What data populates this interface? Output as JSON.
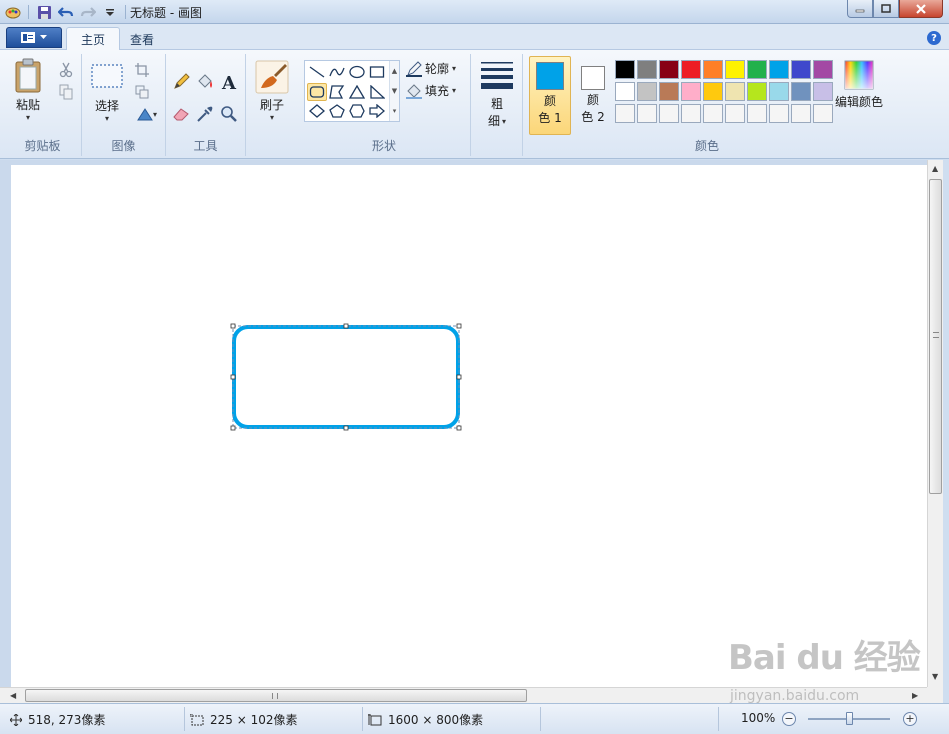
{
  "window": {
    "title": "无标题 - 画图"
  },
  "tabs": [
    {
      "label": "主页",
      "active": true
    },
    {
      "label": "查看",
      "active": false
    }
  ],
  "ribbon": {
    "clipboard": {
      "paste_label": "粘贴",
      "group_label": "剪贴板"
    },
    "image": {
      "select_label": "选择",
      "group_label": "图像"
    },
    "tools": {
      "group_label": "工具"
    },
    "brushes": {
      "label": "刷子"
    },
    "shapes": {
      "outline_label": "轮廓",
      "fill_label": "填充",
      "group_label": "形状"
    },
    "size": {
      "label_line1": "粗",
      "label_line2": "细"
    },
    "colors": {
      "color1_line1": "颜",
      "color1_line2": "色 1",
      "color2_line1": "颜",
      "color2_line2": "色 2",
      "color1_value": "#00a2e8",
      "color2_value": "#ffffff",
      "edit_label": "编辑颜色",
      "group_label": "颜色",
      "palette_row1": [
        "#000000",
        "#7f7f7f",
        "#880015",
        "#ed1c24",
        "#ff7f27",
        "#fff200",
        "#22b14c",
        "#00a2e8",
        "#3f48cc",
        "#a349a4"
      ],
      "palette_row2": [
        "#ffffff",
        "#c3c3c3",
        "#b97a57",
        "#ffaec9",
        "#ffc90e",
        "#efe4b0",
        "#b5e61d",
        "#99d9ea",
        "#7092be",
        "#c8bfe7"
      ],
      "palette_row3": [
        "#f5f5f5",
        "#f5f5f5",
        "#f5f5f5",
        "#f5f5f5",
        "#f5f5f5",
        "#f5f5f5",
        "#f5f5f5",
        "#f5f5f5",
        "#f5f5f5",
        "#f5f5f5"
      ]
    }
  },
  "canvas": {
    "shape_stroke_color": "#00a2e8"
  },
  "status": {
    "cursor_pos": "518, 273像素",
    "selection_size": "225 × 102像素",
    "image_size": "1600 × 800像素",
    "zoom": "100%",
    "zoom_level": 0.5
  },
  "watermark": {
    "main": "Bai du 经验",
    "sub": "jingyan.baidu.com"
  }
}
